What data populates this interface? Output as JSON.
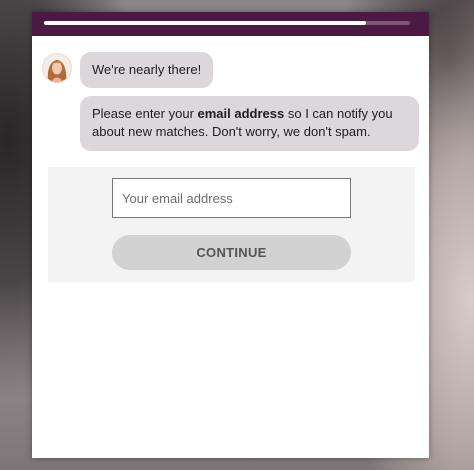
{
  "progress": {
    "value": 0.88
  },
  "chat": {
    "avatar_icon": "person-avatar",
    "message_1": "We're nearly there!",
    "message_2_before": "Please enter your ",
    "message_2_bold": "email address",
    "message_2_after": " so I can notify you about new matches. Don't worry, we don't spam."
  },
  "form": {
    "email_placeholder": "Your email address",
    "email_value": "",
    "continue_label": "CONTINUE"
  },
  "colors": {
    "header": "#4a1a45",
    "bubble": "#dcd7db",
    "panel": "#f3f3f3",
    "button": "#d2d2d2"
  }
}
